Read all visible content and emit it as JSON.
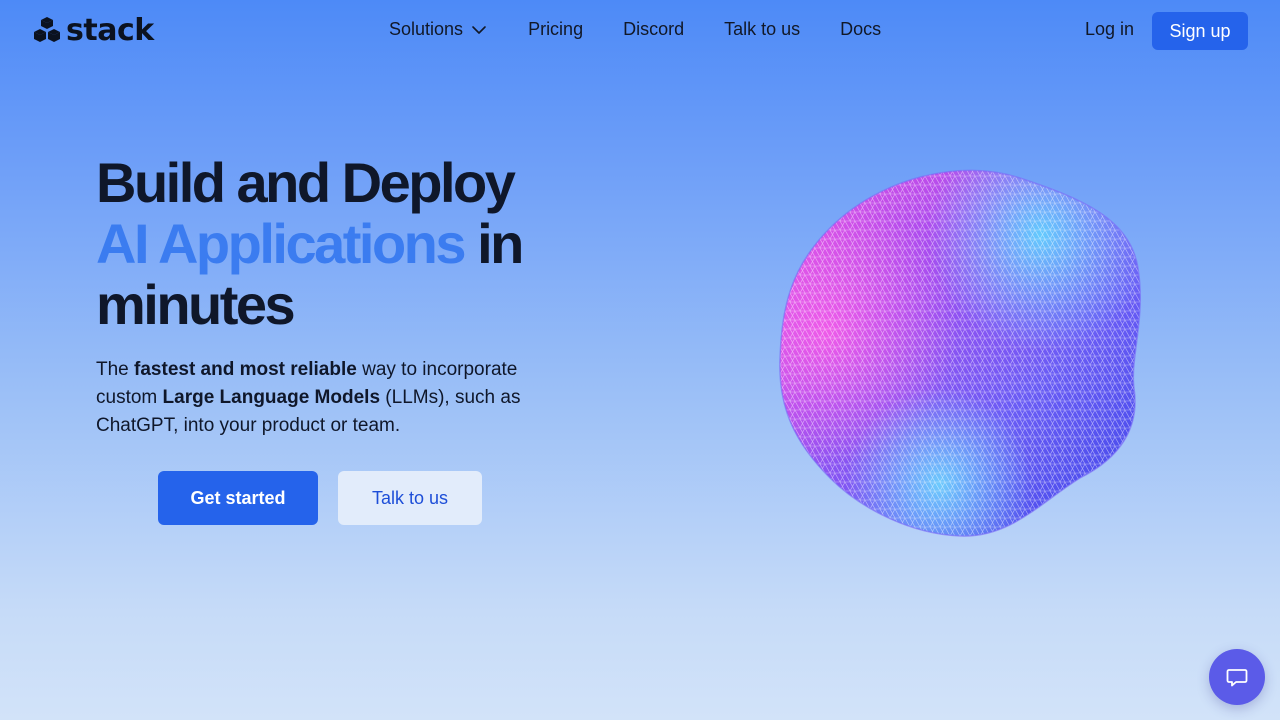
{
  "brand": {
    "name": "stack",
    "logo_icon": "stacked-cubes-icon"
  },
  "nav": {
    "links": [
      {
        "label": "Solutions",
        "has_dropdown": true
      },
      {
        "label": "Pricing"
      },
      {
        "label": "Discord"
      },
      {
        "label": "Talk to us"
      },
      {
        "label": "Docs"
      }
    ],
    "login_label": "Log in",
    "signup_label": "Sign up"
  },
  "hero": {
    "title_line1": "Build and Deploy",
    "title_accent": "AI Applications",
    "title_rest": " in",
    "title_line3": "minutes",
    "sub_1": "The ",
    "sub_bold_1": "fastest and most reliable",
    "sub_2": " way to incorporate custom ",
    "sub_bold_2": "Large Language Models",
    "sub_3": " (LLMs), such as ChatGPT, into your product or team.",
    "primary_button": "Get started",
    "secondary_button": "Talk to us"
  },
  "chat_widget": {
    "icon": "chat-bubble-icon"
  },
  "colors": {
    "accent": "#2563eb",
    "title_accent": "#3b7cf0",
    "chat": "#5b5be8"
  }
}
